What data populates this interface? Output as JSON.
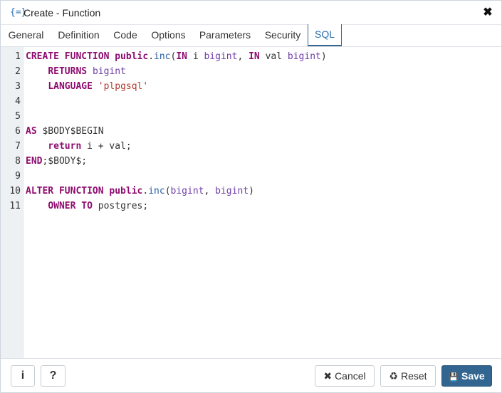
{
  "dialog": {
    "title": "Create - Function",
    "title_icon": "{=}",
    "close_label": "✖"
  },
  "tabs": [
    {
      "label": "General"
    },
    {
      "label": "Definition"
    },
    {
      "label": "Code"
    },
    {
      "label": "Options"
    },
    {
      "label": "Parameters"
    },
    {
      "label": "Security"
    },
    {
      "label": "SQL"
    }
  ],
  "active_tab": "SQL",
  "sql": {
    "line_numbers": [
      "1",
      "2",
      "3",
      "4",
      "5",
      "6",
      "7",
      "8",
      "9",
      "10",
      "11"
    ],
    "lines": [
      [
        {
          "t": "kw",
          "v": "CREATE FUNCTION "
        },
        {
          "t": "kw",
          "v": "public"
        },
        {
          "t": "pl",
          "v": "."
        },
        {
          "t": "fn",
          "v": "inc"
        },
        {
          "t": "pl",
          "v": "("
        },
        {
          "t": "kw",
          "v": "IN"
        },
        {
          "t": "pl",
          "v": " i "
        },
        {
          "t": "ty",
          "v": "bigint"
        },
        {
          "t": "pl",
          "v": ", "
        },
        {
          "t": "kw",
          "v": "IN"
        },
        {
          "t": "pl",
          "v": " val "
        },
        {
          "t": "ty",
          "v": "bigint"
        },
        {
          "t": "pl",
          "v": ")"
        }
      ],
      [
        {
          "t": "pl",
          "v": "    "
        },
        {
          "t": "kw",
          "v": "RETURNS"
        },
        {
          "t": "pl",
          "v": " "
        },
        {
          "t": "ty",
          "v": "bigint"
        }
      ],
      [
        {
          "t": "pl",
          "v": "    "
        },
        {
          "t": "kw",
          "v": "LANGUAGE"
        },
        {
          "t": "pl",
          "v": " "
        },
        {
          "t": "st",
          "v": "'plpgsql'"
        }
      ],
      [],
      [],
      [
        {
          "t": "kw",
          "v": "AS"
        },
        {
          "t": "pl",
          "v": " $BODY$BEGIN"
        }
      ],
      [
        {
          "t": "pl",
          "v": "    "
        },
        {
          "t": "kw",
          "v": "return"
        },
        {
          "t": "pl",
          "v": " i + val;"
        }
      ],
      [
        {
          "t": "kw",
          "v": "END"
        },
        {
          "t": "pl",
          "v": ";$BODY$;"
        }
      ],
      [],
      [
        {
          "t": "kw",
          "v": "ALTER FUNCTION "
        },
        {
          "t": "kw",
          "v": "public"
        },
        {
          "t": "pl",
          "v": "."
        },
        {
          "t": "fn",
          "v": "inc"
        },
        {
          "t": "pl",
          "v": "("
        },
        {
          "t": "ty",
          "v": "bigint"
        },
        {
          "t": "pl",
          "v": ", "
        },
        {
          "t": "ty",
          "v": "bigint"
        },
        {
          "t": "pl",
          "v": ")"
        }
      ],
      [
        {
          "t": "pl",
          "v": "    "
        },
        {
          "t": "kw",
          "v": "OWNER TO"
        },
        {
          "t": "pl",
          "v": " postgres;"
        }
      ]
    ]
  },
  "footer": {
    "info_label": "i",
    "help_label": "?",
    "cancel_label": "Cancel",
    "cancel_icon": "✖",
    "reset_label": "Reset",
    "reset_icon": "♻",
    "save_label": "Save",
    "save_icon": "💾"
  },
  "colors": {
    "accent": "#326690",
    "keyword": "#8e0c6f",
    "type": "#6f3ea8",
    "function": "#2960a8",
    "string": "#b13b2e"
  }
}
